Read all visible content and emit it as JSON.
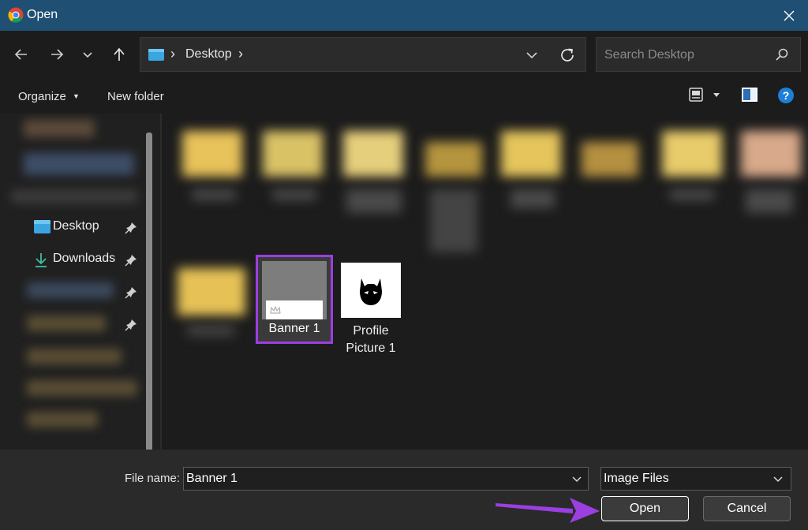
{
  "window": {
    "title": "Open",
    "close_icon": "close-icon",
    "app_icon": "chrome-icon"
  },
  "nav": {
    "back_icon": "arrow-left-icon",
    "forward_icon": "arrow-right-icon",
    "recent_icon": "chevron-down-icon",
    "up_icon": "arrow-up-icon",
    "breadcrumb": [
      "Desktop"
    ],
    "separator": "›",
    "refresh_icon": "refresh-icon",
    "search_placeholder": "Search Desktop"
  },
  "commandbar": {
    "organize_label": "Organize",
    "new_folder_label": "New folder",
    "view_icon": "view-options-icon",
    "preview_icon": "preview-pane-icon",
    "help_icon": "help-icon"
  },
  "sidebar": {
    "items": [
      {
        "label": "Desktop",
        "icon": "desktop-folder-icon",
        "pinned": true
      },
      {
        "label": "Downloads",
        "icon": "download-icon",
        "pinned": true
      }
    ]
  },
  "files": [
    {
      "label": "Banner 1",
      "selected": true
    },
    {
      "label": "Profile Picture 1",
      "label_line1": "Profile",
      "label_line2": "Picture 1",
      "selected": false
    }
  ],
  "footer": {
    "file_name_label": "File name:",
    "file_name_value": "Banner 1",
    "file_type_value": "Image Files",
    "open_label": "Open",
    "cancel_label": "Cancel"
  },
  "colors": {
    "titlebar": "#1f4f73",
    "selection_border": "#9b3fe0",
    "annotation_arrow": "#9b3fe0"
  }
}
